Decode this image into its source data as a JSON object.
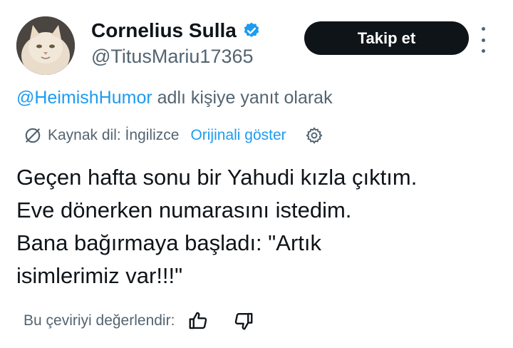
{
  "author": {
    "display_name": "Cornelius Sulla",
    "handle": "@TitusMariu17365",
    "verified": true,
    "verified_color": "#1d9bf0"
  },
  "follow_button": {
    "label": "Takip et"
  },
  "reply_context": {
    "mention": "@HeimishHumor",
    "suffix": " adlı kişiye yanıt olarak"
  },
  "translation": {
    "source_label": "Kaynak dil: İngilizce",
    "show_original_label": "Orijinali göster"
  },
  "tweet": {
    "lines": [
      "Geçen hafta sonu bir Yahudi kızla çıktım.",
      "Eve dönerken numarasını istedim.",
      "Bana bağırmaya başladı: \"Artık",
      "isimlerimiz var!!!\""
    ]
  },
  "rate_translation": {
    "label": "Bu çeviriyi değerlendir:"
  },
  "colors": {
    "text_primary": "#0f1419",
    "text_secondary": "#536471",
    "accent": "#1d9bf0"
  },
  "icons": [
    "verified-badge-icon",
    "more-options-icon",
    "translate-icon",
    "settings-gear-icon",
    "thumbs-up-icon",
    "thumbs-down-icon"
  ]
}
